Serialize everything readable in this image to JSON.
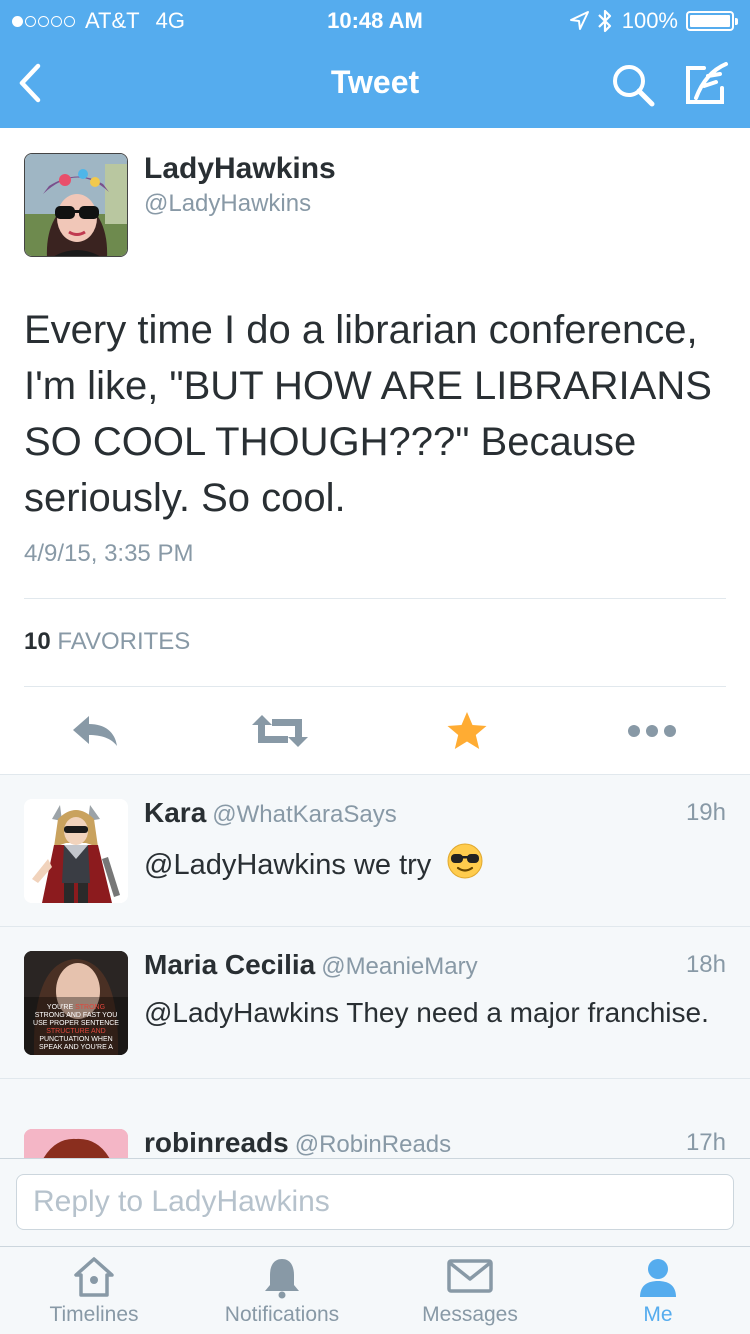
{
  "status_bar": {
    "carrier": "AT&T",
    "network": "4G",
    "time": "10:48 AM",
    "battery": "100%",
    "signal_bars": 1,
    "icons": [
      "location-arrow-icon",
      "bluetooth-icon",
      "battery-icon"
    ]
  },
  "nav": {
    "title": "Tweet",
    "icons": [
      "back-chevron-icon",
      "search-icon",
      "compose-icon"
    ]
  },
  "tweet": {
    "author_name": "LadyHawkins",
    "author_handle": "@LadyHawkins",
    "text": "Every time I do a librarian conference, I'm like, \"BUT HOW ARE LIBRARIANS SO COOL THOUGH???\" Because seriously. So cool.",
    "timestamp": "4/9/15, 3:35 PM",
    "favorites_count": "10",
    "favorites_label": "FAVORITES",
    "favorited": true,
    "actions": [
      "reply-icon",
      "retweet-icon",
      "favorite-star-icon",
      "more-icon"
    ]
  },
  "replies": [
    {
      "name": "Kara",
      "handle": "@WhatKaraSays",
      "time": "19h",
      "text": "@LadyHawkins we try",
      "emoji": "😎"
    },
    {
      "name": "Maria Cecilia",
      "handle": "@MeanieMary",
      "time": "18h",
      "text": "@LadyHawkins They need a major franchise.",
      "avatar_caption": "YOU'RE STRONG AND FAST YOU USE PROPER SENTENCE STRUCTURE AND PUNCTUATION WHEN SPEAK AND YOU'RE A VIRGIN"
    },
    {
      "name": "robinreads",
      "handle": "@RobinReads",
      "time": "17h",
      "text": ""
    }
  ],
  "reply_box": {
    "placeholder": "Reply to LadyHawkins"
  },
  "tabs": [
    {
      "label": "Timelines",
      "icon": "home-icon",
      "active": false
    },
    {
      "label": "Notifications",
      "icon": "bell-icon",
      "active": false
    },
    {
      "label": "Messages",
      "icon": "envelope-icon",
      "active": false
    },
    {
      "label": "Me",
      "icon": "person-icon",
      "active": true
    }
  ],
  "colors": {
    "brand": "#55acee",
    "star": "#ffac33",
    "text": "#292f33",
    "secondary": "#8899a6",
    "divider": "#e1e8ed"
  }
}
